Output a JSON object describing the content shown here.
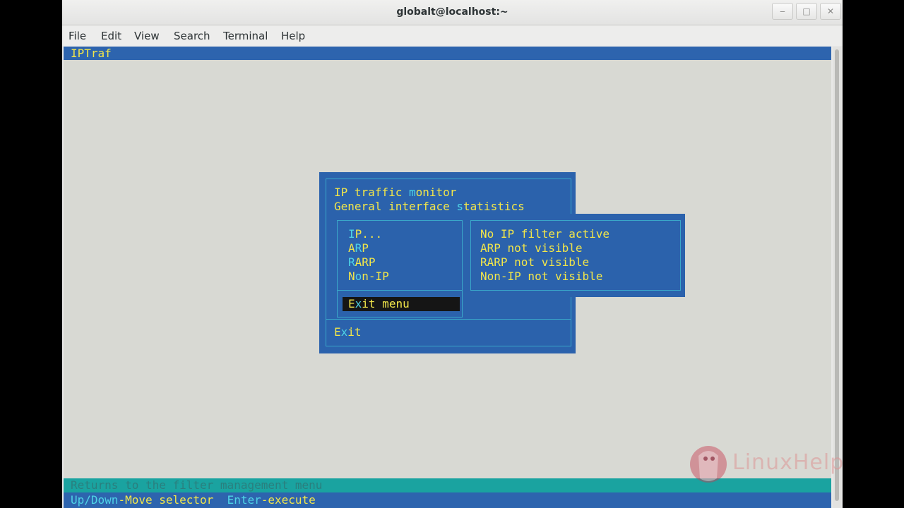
{
  "window": {
    "title": "globalt@localhost:~",
    "controls": {
      "minimize": "‒",
      "maximize": "□",
      "close": "✕"
    }
  },
  "menubar": [
    "File",
    "Edit",
    "View",
    "Search",
    "Terminal",
    "Help"
  ],
  "terminal": {
    "app_title": "IPTraf",
    "main_menu": {
      "item1_pre": "IP traffic ",
      "item1_hot": "m",
      "item1_post": "onitor",
      "item2_pre": "General interface ",
      "item2_hot": "s",
      "item2_post": "tatistics",
      "exit_pre": "E",
      "exit_hot": "x",
      "exit_post": "it"
    },
    "filter_menu": {
      "ip_hot": "I",
      "ip_post": "P...",
      "arp_pre": "A",
      "arp_hot": "R",
      "arp_post": "P",
      "rarp_hot": "R",
      "rarp_post": "ARP",
      "nonip_pre": "N",
      "nonip_hot": "o",
      "nonip_post": "n-IP",
      "exitmenu_pre": "E",
      "exitmenu_hot": "x",
      "exitmenu_post": "it menu"
    },
    "filter_status": [
      "No IP filter active",
      "ARP not visible",
      "RARP not visible",
      "Non-IP not visible"
    ],
    "status_help": "Returns to the filter management menu",
    "keys": {
      "k1": "Up/Down",
      "k1_desc": "-Move selector",
      "k2": "Enter",
      "k2_desc": "-execute"
    }
  },
  "watermark": {
    "brand": "LinuxHelp"
  },
  "colors": {
    "panel_blue": "#2b62ac",
    "text_yellow": "#f2e64a",
    "hotkey_cyan": "#4ed4e6",
    "status_teal": "#1aa3a0",
    "terminal_bg": "#d8d9d3"
  }
}
